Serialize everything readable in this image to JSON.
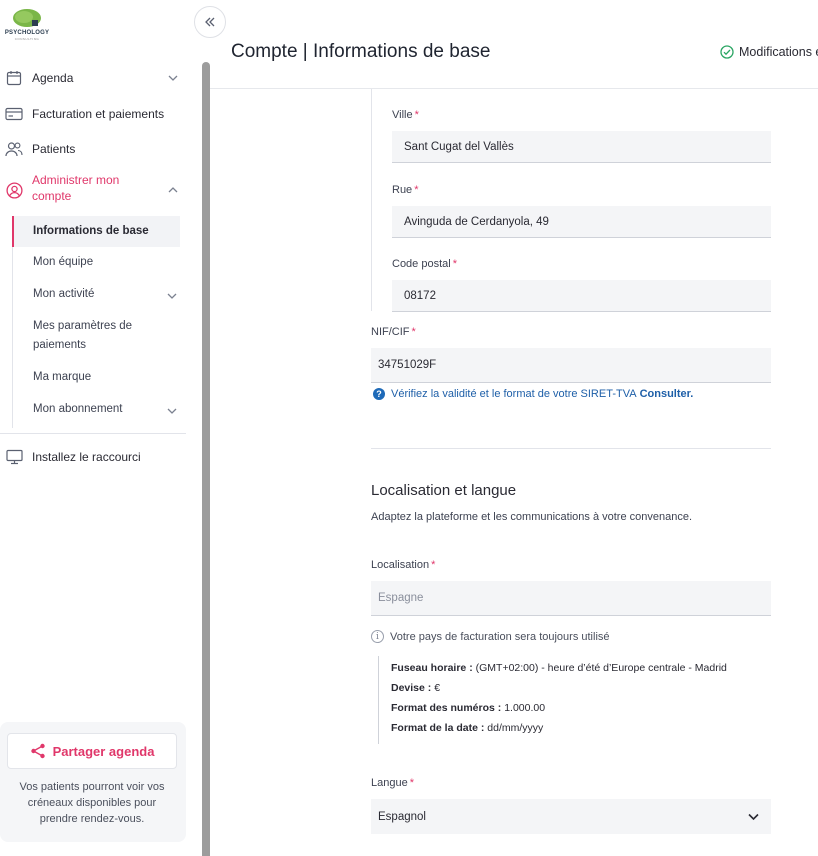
{
  "brand": {
    "logo_text": "PSYCHOLOGY",
    "logo_sub": "CONSULTING"
  },
  "sidebar": {
    "items": [
      {
        "label": "Agenda",
        "icon": "calendar-icon"
      },
      {
        "label": "Facturation et paiements",
        "icon": "credit-card-icon"
      },
      {
        "label": "Patients",
        "icon": "users-icon"
      },
      {
        "label": "Administrer mon compte",
        "icon": "user-circle-icon"
      },
      {
        "label": "Installez le raccourci",
        "icon": "monitor-icon"
      }
    ],
    "admin_line1": "Administrer mon",
    "admin_line2": "compte",
    "sub_items": [
      {
        "label": "Informations de base"
      },
      {
        "label": "Mon équipe"
      },
      {
        "label": "Mon activité"
      },
      {
        "label": "Mes paramètres de"
      },
      {
        "label": "paiements"
      },
      {
        "label": "Ma marque"
      },
      {
        "label": "Mon abonnement"
      }
    ],
    "share": {
      "button": "Partager agenda",
      "desc1": "Vos patients pourront voir vos",
      "desc2": "créneaux disponibles pour",
      "desc3": "prendre rendez-vous."
    }
  },
  "header": {
    "title": "Compte | Informations de base",
    "status": "Modifications e"
  },
  "form": {
    "city": {
      "label": "Ville",
      "value": "Sant Cugat del Vallès"
    },
    "street": {
      "label": "Rue",
      "value": "Avinguda de Cerdanyola, 49"
    },
    "postal": {
      "label": "Code postal",
      "value": "08172"
    },
    "nif": {
      "label": "NIF/CIF",
      "value": "34751029F"
    },
    "help_text": "Vérifiez la validité et le format de votre SIRET-TVA",
    "help_link": "Consulter."
  },
  "locale": {
    "title": "Localisation et langue",
    "subtitle": "Adaptez la plateforme et les communications à votre convenance.",
    "localisation_label": "Localisation",
    "localisation_placeholder": "Espagne",
    "note": "Votre pays de facturation sera toujours utilisé",
    "details": [
      {
        "k": "Fuseau horaire :",
        "v": " (GMT+02:00) - heure d’été d’Europe centrale - Madrid"
      },
      {
        "k": "Devise :",
        "v": " €"
      },
      {
        "k": "Format des numéros :",
        "v": " 1.000.00"
      },
      {
        "k": "Format de la date :",
        "v": " dd/mm/yyyy"
      }
    ],
    "language_label": "Langue",
    "language_value": "Espagnol"
  },
  "colors": {
    "accent": "#e0376a",
    "link": "#1e5fa8"
  }
}
